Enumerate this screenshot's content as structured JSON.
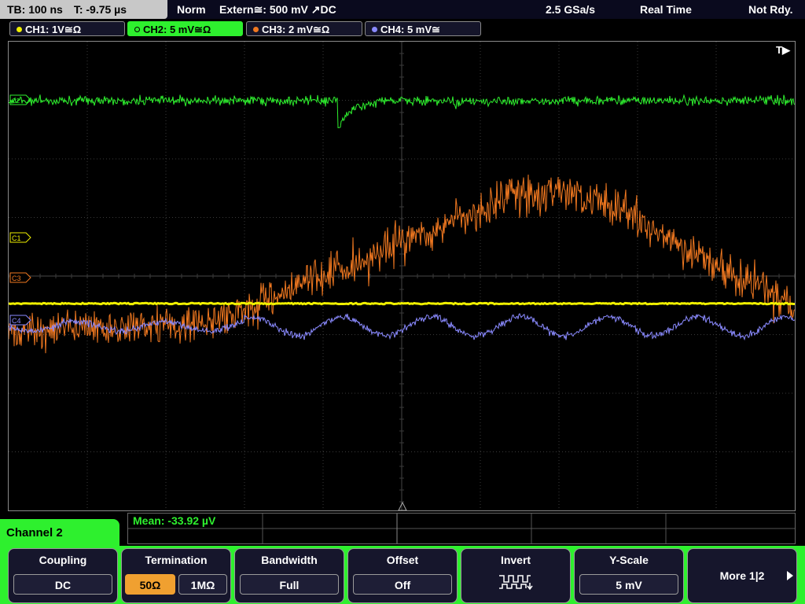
{
  "topbar": {
    "timebase": "TB: 100 ns",
    "trigger_time": "T: -9.75 µs",
    "mode": "Norm",
    "trigger_source": "Extern≅: 500 mV ↗DC",
    "sample_rate": "2.5 GSa/s",
    "acq_mode": "Real Time",
    "status": "Not Rdy."
  },
  "channels": [
    {
      "label": "CH1: 1V≅Ω",
      "color": "#f0f000"
    },
    {
      "label": "CH2: 5 mV≅Ω",
      "color": "#2ef02e",
      "active": true
    },
    {
      "label": "CH3: 2 mV≅Ω",
      "color": "#f07820"
    },
    {
      "label": "CH4: 5 mV≅",
      "color": "#8a8aff"
    }
  ],
  "screen": {
    "trigger_marker": "T▶",
    "markers": {
      "c1": "C1",
      "c3": "C3",
      "c4": "C4",
      "c2": "C2"
    }
  },
  "measurement": {
    "text": "Mean: -33.92 µV"
  },
  "menu": {
    "channel_label": "Channel 2",
    "coupling": {
      "title": "Coupling",
      "value": "DC"
    },
    "termination": {
      "title": "Termination",
      "options": [
        "50Ω",
        "1MΩ"
      ],
      "selected": "50Ω"
    },
    "bandwidth": {
      "title": "Bandwidth",
      "value": "Full"
    },
    "offset": {
      "title": "Offset",
      "value": "Off"
    },
    "invert": {
      "title": "Invert",
      "icon": "invert-square-wave-icon"
    },
    "yscale": {
      "title": "Y-Scale",
      "value": "5 mV"
    },
    "more": {
      "label": "More 1|2"
    }
  },
  "colors": {
    "ch1": "#f0f000",
    "ch2": "#2ef02e",
    "ch3": "#f07820",
    "ch4": "#8a8aff",
    "grid": "#3a3a3a",
    "accent_orange": "#f0a030"
  }
}
